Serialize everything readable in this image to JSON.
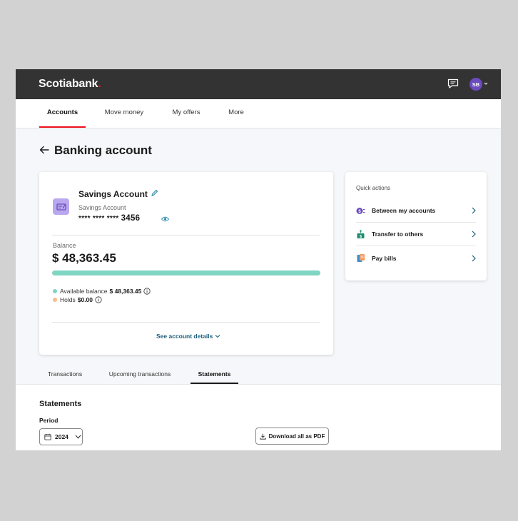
{
  "header": {
    "logo_text": "Scotiabank",
    "logo_dot": ".",
    "user_initials": "SB",
    "icons": {
      "chat": "chat-bubble-icon",
      "caret": "chevron-down-icon"
    }
  },
  "nav": {
    "tabs": [
      {
        "label": "Accounts",
        "active": true
      },
      {
        "label": "Move money",
        "active": false
      },
      {
        "label": "My offers",
        "active": false
      },
      {
        "label": "More",
        "active": false
      }
    ]
  },
  "page": {
    "title": "Banking account"
  },
  "account": {
    "name": "Savings Account",
    "type": "Savings Account",
    "masked_number": "**** **** ****",
    "last4": "3456",
    "balance_label": "Balance",
    "balance": "$ 48,363.45",
    "available_fraction": 1.0,
    "available_label": "Available balance",
    "available_value": "$ 48,363.45",
    "holds_label": "Holds",
    "holds_value": "$0.00",
    "details_link": "See account details",
    "colors": {
      "available": "#7fd6c2",
      "holds": "#ffb98a",
      "icon_bg": "#b9a7ef"
    }
  },
  "quick_actions": {
    "title": "Quick actions",
    "items": [
      {
        "label": "Between my accounts",
        "icon": "transfer-accounts-icon"
      },
      {
        "label": "Transfer to others",
        "icon": "send-money-icon"
      },
      {
        "label": "Pay bills",
        "icon": "bill-icon"
      }
    ]
  },
  "tabs": [
    {
      "label": "Transactions",
      "active": false
    },
    {
      "label": "Upcoming transactions",
      "active": false
    },
    {
      "label": "Statements",
      "active": true
    }
  ],
  "statements": {
    "title": "Statements",
    "period_label": "Period",
    "period_value": "2024",
    "download_label": "Download all as PDF"
  },
  "colors": {
    "brand_red": "#ec111a",
    "topbar": "#333333",
    "link": "#1b5f7a"
  }
}
